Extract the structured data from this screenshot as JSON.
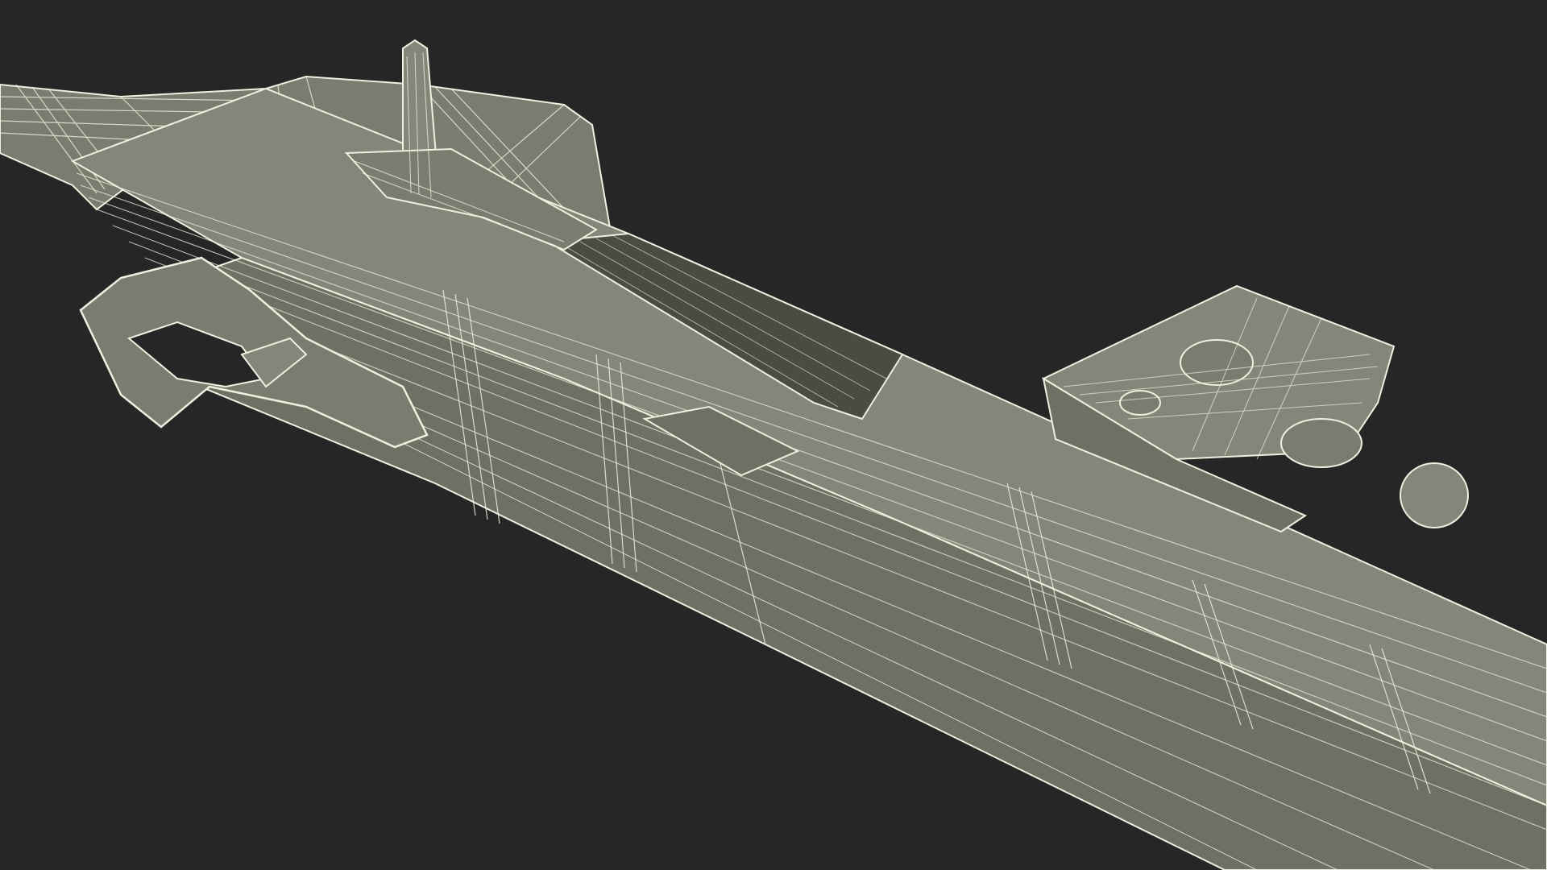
{
  "colors": {
    "background": "#262626",
    "surface": "#7b7c6f",
    "surface_light": "#85867a",
    "surface_dark": "#5f6056",
    "shadow": "#4a4b43",
    "wire": "#efefdf"
  }
}
